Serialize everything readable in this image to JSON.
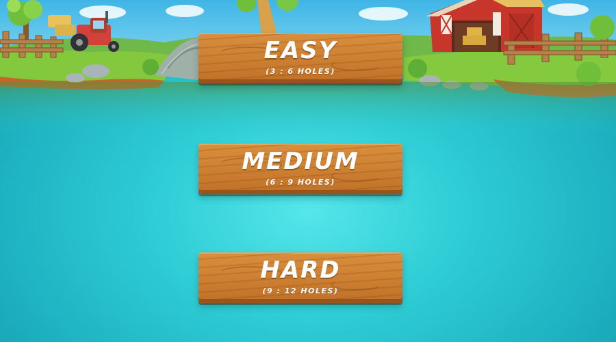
{
  "menu": {
    "easy": {
      "label": "EASY",
      "holes": "(3 : 6 HOLES)"
    },
    "medium": {
      "label": "MEDIUM",
      "holes": "(6 : 9 HOLES)"
    },
    "hard": {
      "label": "HARD",
      "holes": "(9 : 12 HOLES)"
    }
  },
  "colors": {
    "water": "#2fcdd6",
    "sky": "#4fc0e8",
    "grass": "#7cc63a",
    "plank": "#cc7f31",
    "barn": "#c8352a"
  },
  "icons": [
    "tractor-icon",
    "barn-icon",
    "tree-icon",
    "fence-icon",
    "stone-bridge-icon",
    "hay-bale-icon"
  ]
}
